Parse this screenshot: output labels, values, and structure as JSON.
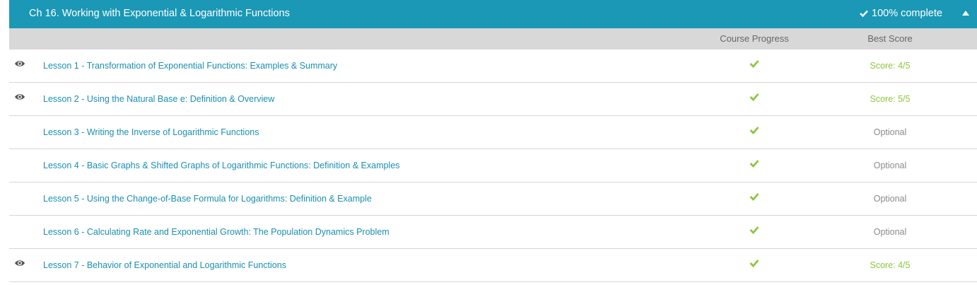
{
  "chapter": {
    "title": "Ch 16. Working with Exponential & Logarithmic Functions",
    "complete": "100% complete",
    "header_color": "#1a98b5"
  },
  "columns": {
    "progress": "Course Progress",
    "score": "Best Score"
  },
  "colors": {
    "check": "#8cc63f",
    "link": "#1a8fb0",
    "optional": "#8a8a8a"
  },
  "lessons": [
    {
      "title": "Lesson 1 - Transformation of Exponential Functions: Examples & Summary",
      "viewed": true,
      "progress": "complete",
      "score": "Score: 4/5",
      "score_type": "graded"
    },
    {
      "title": "Lesson 2 - Using the Natural Base e: Definition & Overview",
      "viewed": true,
      "progress": "complete",
      "score": "Score: 5/5",
      "score_type": "graded"
    },
    {
      "title": "Lesson 3 - Writing the Inverse of Logarithmic Functions",
      "viewed": false,
      "progress": "complete",
      "score": "Optional",
      "score_type": "optional"
    },
    {
      "title": "Lesson 4 - Basic Graphs & Shifted Graphs of Logarithmic Functions: Definition & Examples",
      "viewed": false,
      "progress": "complete",
      "score": "Optional",
      "score_type": "optional"
    },
    {
      "title": "Lesson 5 - Using the Change-of-Base Formula for Logarithms: Definition & Example",
      "viewed": false,
      "progress": "complete",
      "score": "Optional",
      "score_type": "optional"
    },
    {
      "title": "Lesson 6 - Calculating Rate and Exponential Growth: The Population Dynamics Problem",
      "viewed": false,
      "progress": "complete",
      "score": "Optional",
      "score_type": "optional"
    },
    {
      "title": "Lesson 7 - Behavior of Exponential and Logarithmic Functions",
      "viewed": true,
      "progress": "complete",
      "score": "Score: 4/5",
      "score_type": "graded"
    }
  ]
}
